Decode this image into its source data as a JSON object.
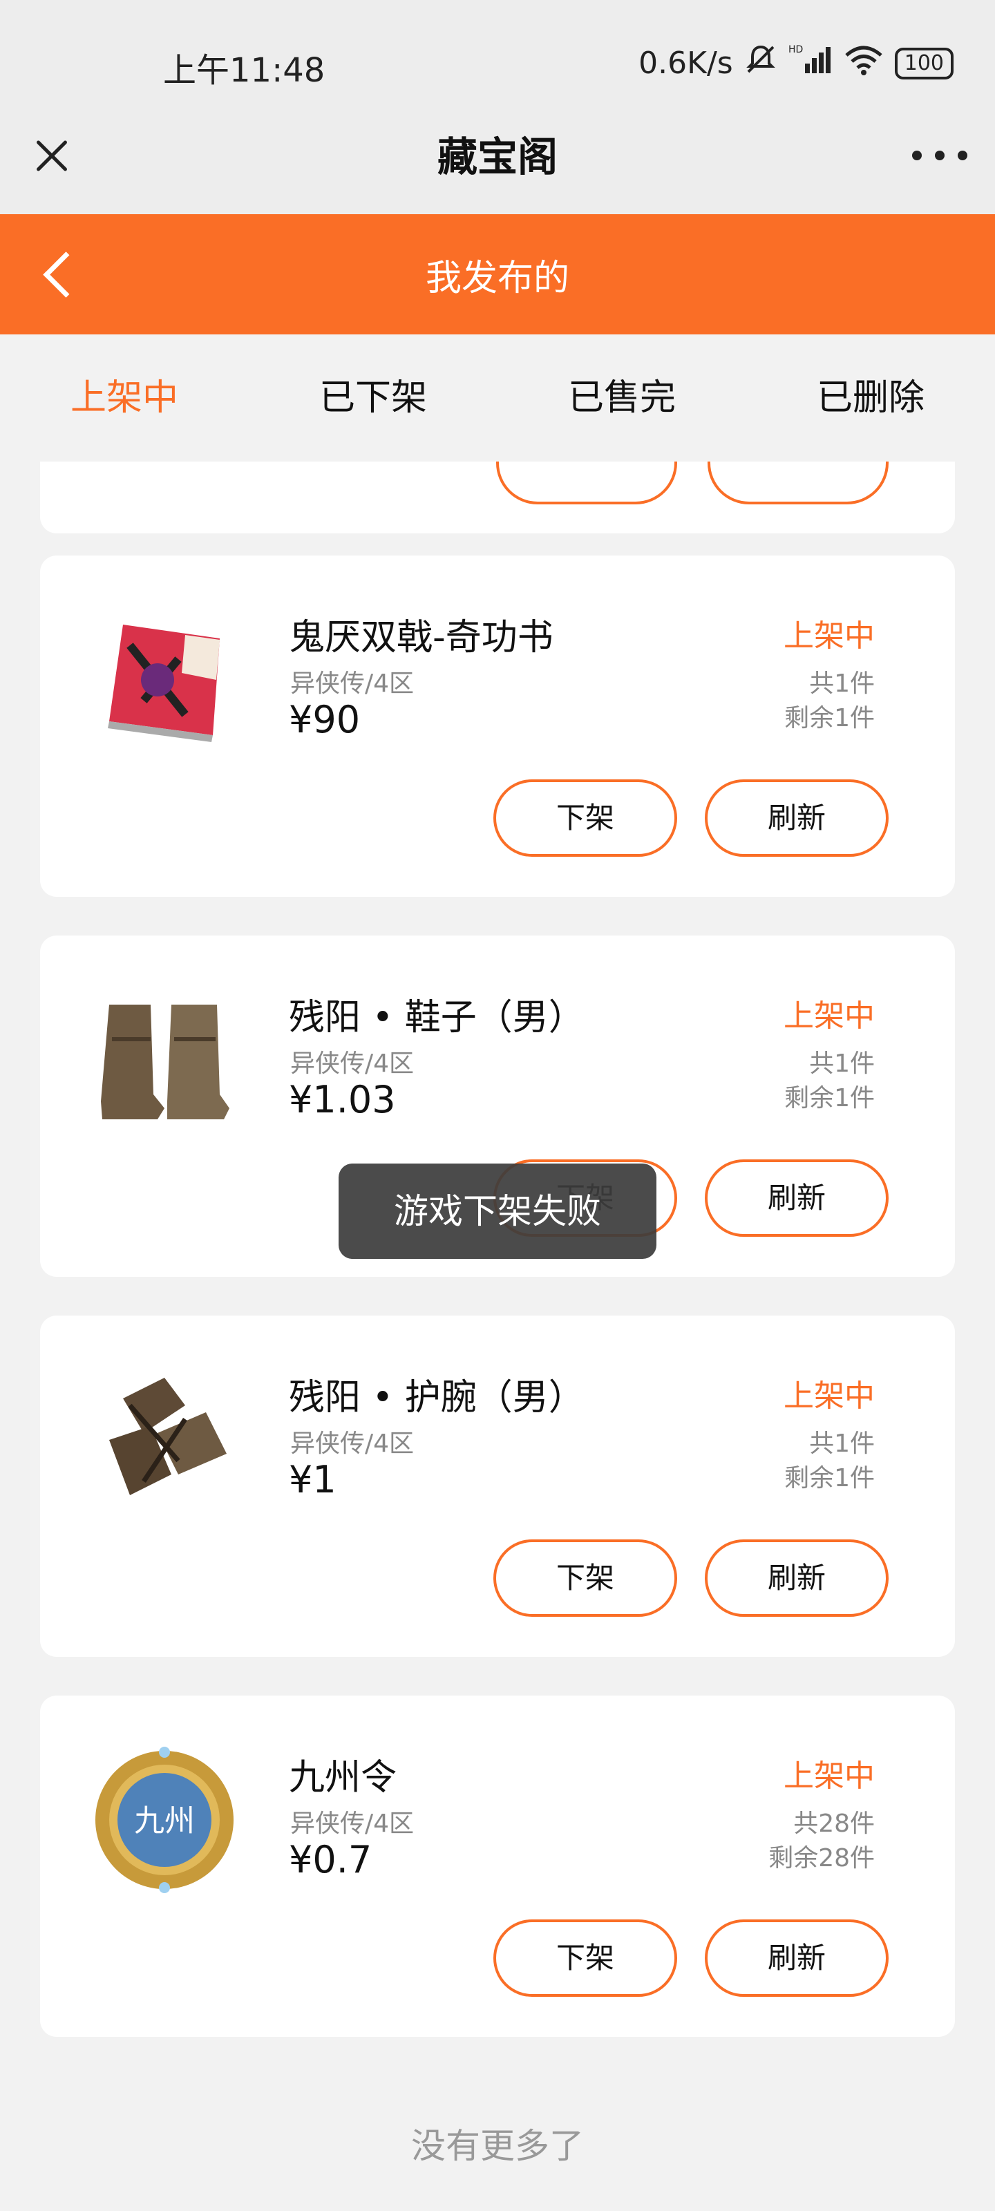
{
  "status_bar": {
    "time": "上午11:48",
    "network_speed": "0.6K/s",
    "signal_label": "HD",
    "battery": "100"
  },
  "wechat_bar": {
    "title": "藏宝阁"
  },
  "header": {
    "title": "我发布的"
  },
  "tabs": [
    {
      "label": "上架中",
      "active": true
    },
    {
      "label": "已下架",
      "active": false
    },
    {
      "label": "已售完",
      "active": false
    },
    {
      "label": "已删除",
      "active": false
    }
  ],
  "items": [
    {
      "title": "鬼厌双戟-奇功书",
      "server": "异侠传/4区",
      "price": "¥90",
      "status": "上架中",
      "total": "共1件",
      "remaining": "剩余1件",
      "off_label": "下架",
      "refresh_label": "刷新",
      "icon": "red-book-icon"
    },
    {
      "title": "残阳 • 鞋子（男）",
      "server": "异侠传/4区",
      "price": "¥1.03",
      "status": "上架中",
      "total": "共1件",
      "remaining": "剩余1件",
      "off_label": "下架",
      "refresh_label": "刷新",
      "icon": "boots-icon"
    },
    {
      "title": "残阳 • 护腕（男）",
      "server": "异侠传/4区",
      "price": "¥1",
      "status": "上架中",
      "total": "共1件",
      "remaining": "剩余1件",
      "off_label": "下架",
      "refresh_label": "刷新",
      "icon": "bracers-icon"
    },
    {
      "title": "九州令",
      "server": "异侠传/4区",
      "price": "¥0.7",
      "status": "上架中",
      "total": "共28件",
      "remaining": "剩余28件",
      "off_label": "下架",
      "refresh_label": "刷新",
      "icon": "jiuzhou-token-icon",
      "icon_text": "九州"
    }
  ],
  "toast": "游戏下架失败",
  "footer": "没有更多了",
  "colors": {
    "accent": "#fa6e26",
    "background": "#f2f2f2"
  }
}
